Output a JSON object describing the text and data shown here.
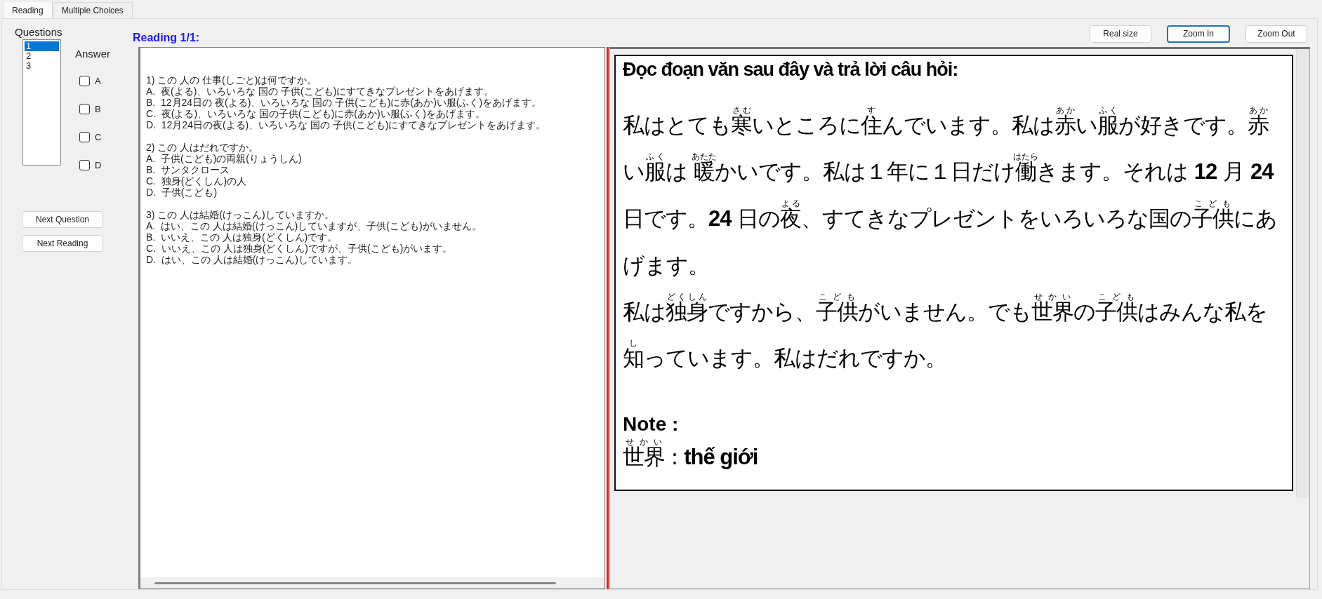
{
  "tabs": [
    {
      "label": "Reading",
      "selected": true
    },
    {
      "label": "Multiple Choices",
      "selected": false
    }
  ],
  "questions": {
    "title": "Questions",
    "items": [
      {
        "label": "1",
        "selected": true
      },
      {
        "label": "2",
        "selected": false
      },
      {
        "label": "3",
        "selected": false
      }
    ]
  },
  "answer": {
    "title": "Answer",
    "options": [
      {
        "label": "A",
        "checked": false
      },
      {
        "label": "B",
        "checked": false
      },
      {
        "label": "C",
        "checked": false
      },
      {
        "label": "D",
        "checked": false
      }
    ]
  },
  "buttons": [
    "Next Question",
    "Next Reading"
  ],
  "reading_title": "Reading 1/1:",
  "question_text": [
    {
      "lines": [
        "1) この 人の 仕事(しごと)は何ですか。",
        "A.  夜(よる)、いろいろな 国の 子供(こども)にすてきなプレゼントをあげます。",
        "B.  12月24日の 夜(よる)、いろいろな 国の 子供(こども)に赤(あか)い服(ふく)をあげます。",
        "C.  夜(よる)、いろいろな 国の子供(こども)に赤(あか)い服(ふく)をあげます。",
        "D.  12月24日の夜(よる)、いろいろな 国の 子供(こども)にすてきなプレゼントをあげます。"
      ]
    },
    {
      "lines": [
        "2) この 人はだれですか。",
        "A.  子供(こども)の両親(りょうしん)",
        "B.  サンタクロース",
        "C.  独身(どくしん)の人",
        "D.  子供(こども)"
      ]
    },
    {
      "lines": [
        "3) この 人は結婚(けっこん)していますか。",
        "A.  はい、この 人は結婚(けっこん)していますが、子供(こども)がいません。",
        "B.  いいえ、この 人は独身(どくしん)です。",
        "C.  いいえ、この 人は独身(どくしん)ですが、子供(こども)がいます。",
        "D.  はい、この 人は結婚(けっこん)しています。"
      ]
    }
  ],
  "zoom_buttons": [
    {
      "label": "Real size",
      "focused": false
    },
    {
      "label": "Zoom In",
      "focused": true
    },
    {
      "label": "Zoom Out",
      "focused": false
    }
  ],
  "passage": {
    "heading": "Đọc đoạn văn sau đây và trả lời câu hỏi:",
    "paragraphs": [
      [
        {
          "text": "私はとても"
        },
        {
          "text": "寒",
          "ruby": "さむ"
        },
        {
          "text": "いところに"
        },
        {
          "text": "住",
          "ruby": "す"
        },
        {
          "text": "んでいます。私は"
        },
        {
          "text": "赤",
          "ruby": "あか"
        },
        {
          "text": "い"
        },
        {
          "text": "服",
          "ruby": "ふく"
        },
        {
          "text": "が好きです。"
        },
        {
          "text": "赤",
          "ruby": "あか"
        },
        {
          "text": "い"
        },
        {
          "text": "服",
          "ruby": "ふく"
        },
        {
          "text": "は "
        },
        {
          "text": "暖",
          "ruby": "あたた"
        },
        {
          "text": "かいです。私は１年に１日だけ"
        },
        {
          "text": "働",
          "ruby": "はたら"
        },
        {
          "text": "きます。それは **12** 月 **24** 日です。**24** 日の"
        },
        {
          "text": "夜",
          "ruby": "よる"
        },
        {
          "text": "、すてきなプレゼントをいろいろな国の"
        },
        {
          "text": "子供",
          "ruby": "こども"
        },
        {
          "text": "にあげます。"
        }
      ],
      [
        {
          "text": "私は"
        },
        {
          "text": "独身",
          "ruby": "どくしん"
        },
        {
          "text": "ですから、"
        },
        {
          "text": "子供",
          "ruby": "こども"
        },
        {
          "text": "がいません。でも"
        },
        {
          "text": "世界",
          "ruby": "せかい"
        },
        {
          "text": "の"
        },
        {
          "text": "子供",
          "ruby": "こども"
        },
        {
          "text": "はみんな私を"
        },
        {
          "text": "知",
          "ruby": "し"
        },
        {
          "text": "っています。私はだれですか。"
        }
      ]
    ],
    "note_heading": "Note :",
    "note": [
      {
        "text": "世界",
        "ruby": "せかい"
      },
      {
        "text": " : **thế giới**"
      }
    ]
  }
}
